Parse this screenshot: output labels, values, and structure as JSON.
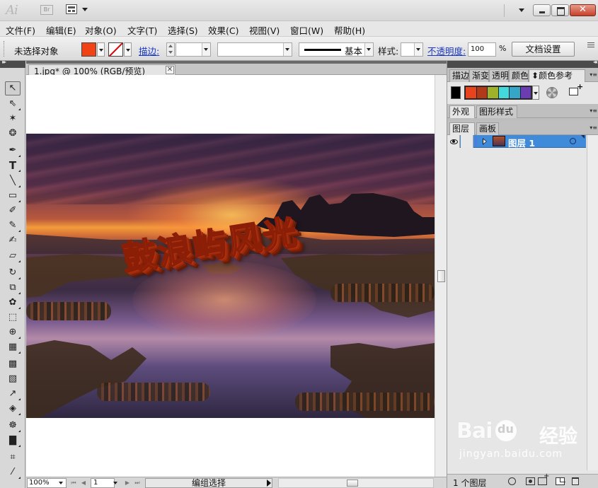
{
  "titlebar": {
    "app_logo": "Ai",
    "bridge_label": "Br"
  },
  "menubar": {
    "items": [
      "文件(F)",
      "编辑(E)",
      "对象(O)",
      "文字(T)",
      "选择(S)",
      "效果(C)",
      "视图(V)",
      "窗口(W)",
      "帮助(H)"
    ]
  },
  "controlbar": {
    "selection_status": "未选择对象",
    "fill_color": "#f04214",
    "stroke_label": "描边:",
    "stroke_profile": "基本",
    "style_label": "样式:",
    "opacity_label": "不透明度:",
    "opacity_value": "100",
    "opacity_unit": "%",
    "doc_setup_button": "文档设置"
  },
  "document": {
    "tab_title": "1.jpg* @ 100% (RGB/预览)",
    "headline_text": "鼓浪屿风光"
  },
  "statusbar": {
    "zoom": "100%",
    "page": "1",
    "status_text": "编组选择"
  },
  "panels": {
    "top_tabs": [
      "描边",
      "渐变",
      "透明",
      "颜色",
      "颜色参考"
    ],
    "harmony_colors": [
      "#e8431c",
      "#b0391a",
      "#9fb22a",
      "#43d8dc",
      "#35a6c7",
      "#6a3eb0"
    ],
    "mid_tabs": [
      "外观",
      "图形样式"
    ],
    "layer_tabs": [
      "图层",
      "画板"
    ],
    "layers": [
      {
        "name": "图层 1"
      }
    ],
    "layers_count": "1 个图层"
  },
  "watermark": {
    "logo": "Bai",
    "cn": "经验",
    "url": "jingyan.baidu.com"
  }
}
